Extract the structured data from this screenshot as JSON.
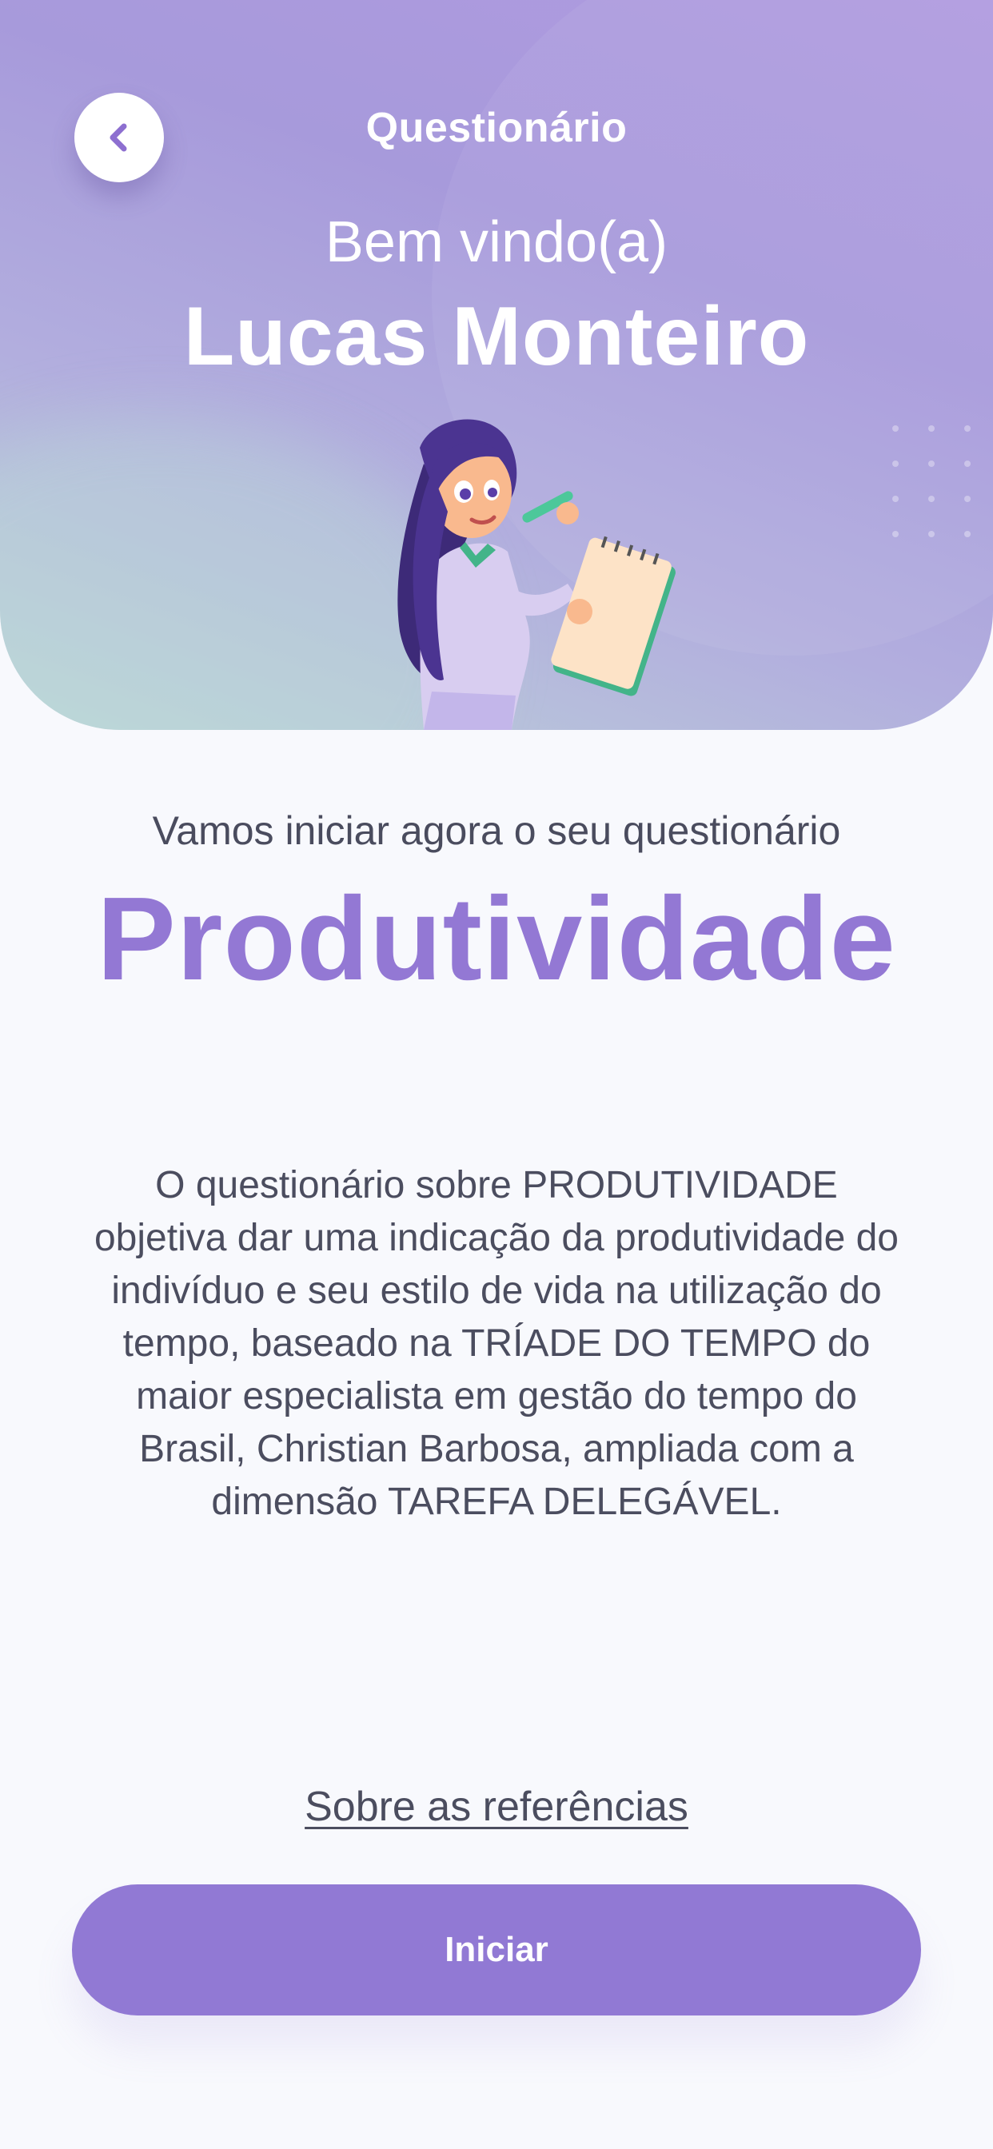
{
  "header": {
    "title": "Questionário",
    "back_icon": "chevron-left-icon"
  },
  "hero": {
    "welcome": "Bem vindo(a)",
    "user_name": "Lucas Monteiro",
    "illustration": "woman-with-notepad-illustration"
  },
  "content": {
    "intro": "Vamos iniciar agora o seu questionário",
    "topic": "Produtividade",
    "description": "O questionário sobre PRODUTIVIDADE objetiva dar uma indicação da produtividade do indivíduo e seu estilo de vida na utilização do tempo, baseado na TRÍADE DO TEMPO do maior especialista em gestão do tempo do Brasil, Christian Barbosa, ampliada com a dimensão TAREFA DELEGÁVEL.",
    "references_link": "Sobre as referências"
  },
  "actions": {
    "start_label": "Iniciar"
  },
  "colors": {
    "accent": "#9179d4",
    "topic_text": "#9378d4",
    "body_text": "#4b4d5f",
    "background": "#f8f9fd"
  }
}
